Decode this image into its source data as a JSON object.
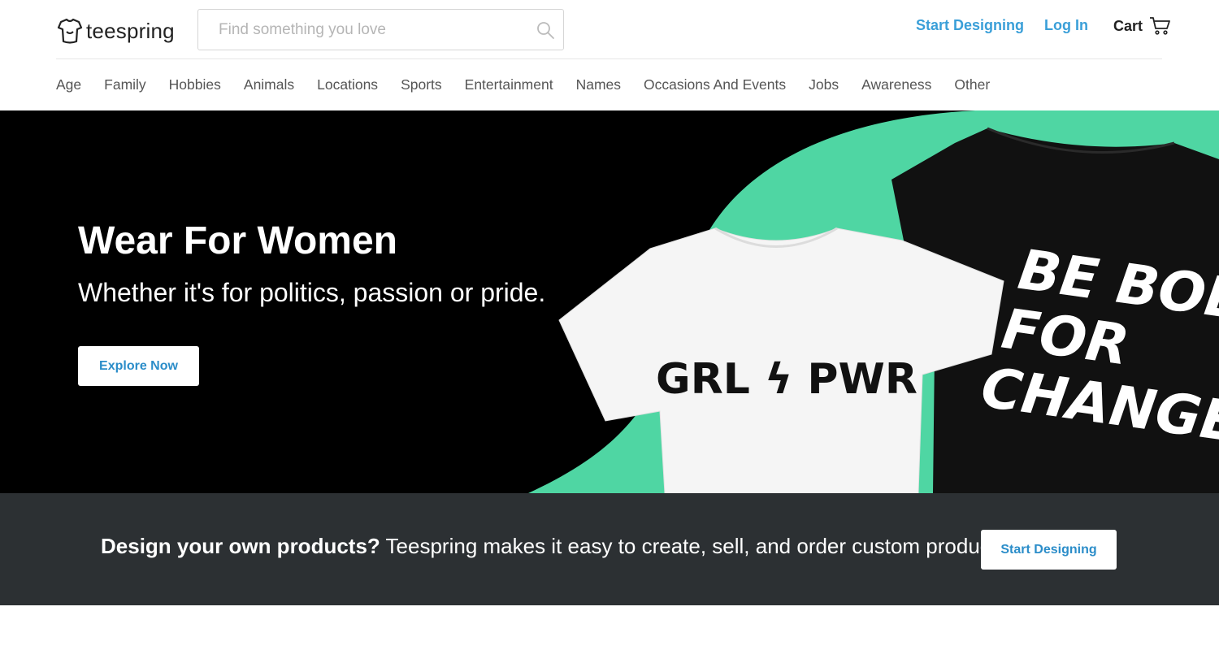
{
  "header": {
    "logo_text": "teespring",
    "search_placeholder": "Find something you love",
    "start_designing": "Start Designing",
    "log_in": "Log In",
    "cart": "Cart"
  },
  "categories": [
    "Age",
    "Family",
    "Hobbies",
    "Animals",
    "Locations",
    "Sports",
    "Entertainment",
    "Names",
    "Occasions And Events",
    "Jobs",
    "Awareness",
    "Other"
  ],
  "hero": {
    "title": "Wear For Women",
    "subtitle": "Whether it's for politics, passion or pride.",
    "button": "Explore Now",
    "shirt_white_text": "GRL ϟ PWR",
    "shirt_black_lines": [
      "BE BOLD",
      "FOR",
      "CHANGE"
    ],
    "accent_color": "#4fd6a3"
  },
  "banner": {
    "bold": "Design your own products?",
    "text": " Teespring makes it easy to create, sell, and order custom products.",
    "button": "Start Designing"
  }
}
